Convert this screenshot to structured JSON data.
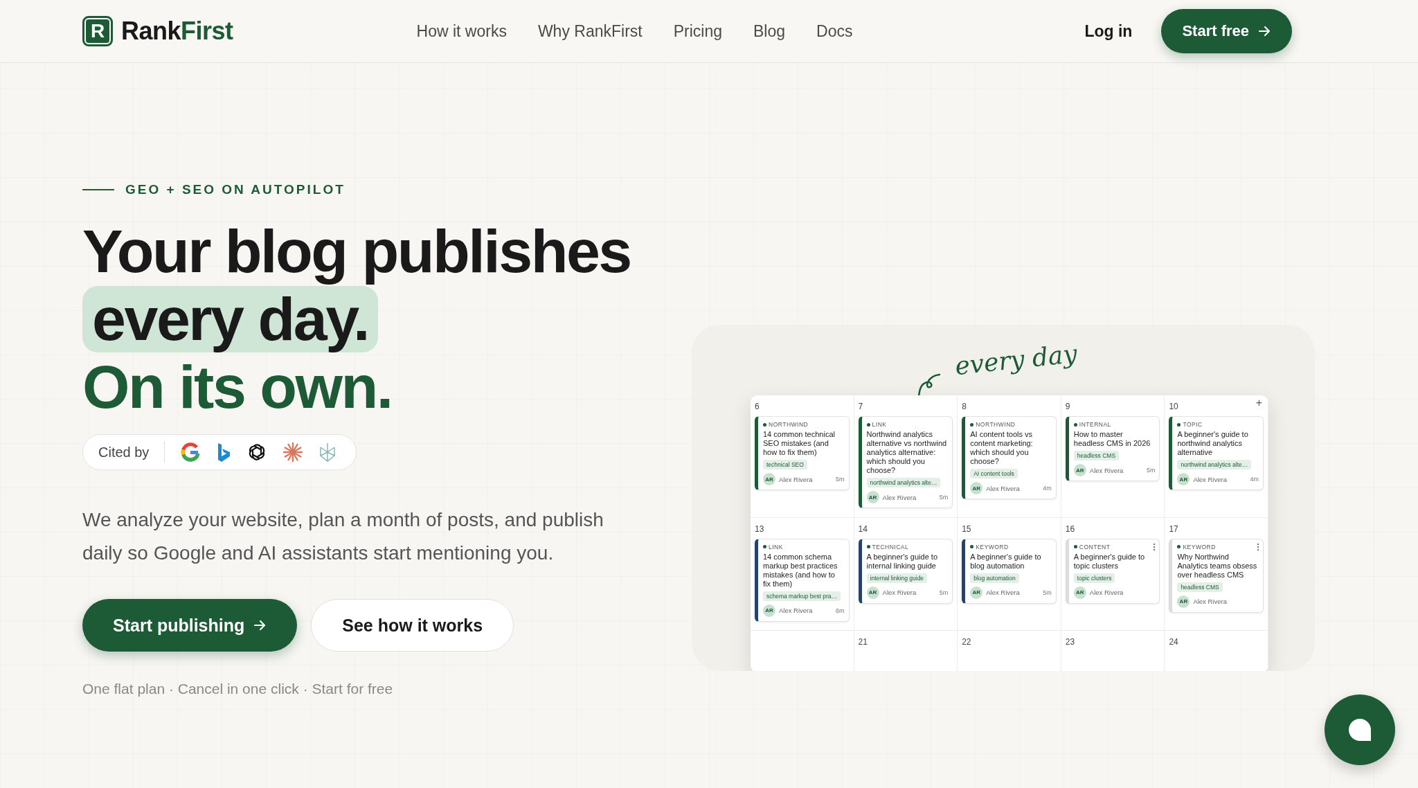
{
  "header": {
    "logo": {
      "mark": "R",
      "name_start": "Rank",
      "name_end": "First"
    },
    "nav": [
      "How it works",
      "Why RankFirst",
      "Pricing",
      "Blog",
      "Docs"
    ],
    "login": "Log in",
    "cta": "Start free"
  },
  "hero": {
    "eyebrow": "GEO + SEO ON AUTOPILOT",
    "headline_1": "Your blog publishes",
    "headline_2": "every day.",
    "headline_3": "On its own.",
    "cited_by": "Cited by",
    "description": "We analyze your website, plan a month of posts, and publish daily so Google and AI assistants start mentioning you.",
    "primary_button": "Start publishing",
    "secondary_button": "See how it works",
    "footnote": "One flat plan · Cancel in one click · Start for free"
  },
  "preview": {
    "annotation": "every day",
    "weeks": [
      {
        "days": [
          {
            "day": "6",
            "post": {
              "label": "NORTHWIND",
              "title": "14 common technical SEO mistakes (and how to fix them)",
              "tag": "technical SEO",
              "initials": "AR",
              "author": "Alex Rivera",
              "time": "5m",
              "color": "#1d5a36"
            }
          },
          {
            "day": "7",
            "post": {
              "label": "LINK",
              "title": "Northwind analytics alternative vs northwind analytics alternative: which should you choose?",
              "tag": "northwind analytics alte…",
              "initials": "AR",
              "author": "Alex Rivera",
              "time": "5m",
              "color": "#1d5a36"
            }
          },
          {
            "day": "8",
            "post": {
              "label": "NORTHWIND",
              "title": "AI content tools vs content marketing: which should you choose?",
              "tag": "AI content tools",
              "initials": "AR",
              "author": "Alex Rivera",
              "time": "4m",
              "color": "#1d5a36"
            }
          },
          {
            "day": "9",
            "post": {
              "label": "INTERNAL",
              "title": "How to master headless CMS in 2026",
              "tag": "headless CMS",
              "initials": "AR",
              "author": "Alex Rivera",
              "time": "5m",
              "color": "#1d5a36"
            }
          },
          {
            "day": "10",
            "add": "+",
            "post": {
              "label": "TOPIC",
              "title": "A beginner's guide to northwind analytics alternative",
              "tag": "northwind analytics alte…",
              "initials": "AR",
              "author": "Alex Rivera",
              "time": "4m",
              "color": "#1d5a36"
            }
          }
        ]
      },
      {
        "days": [
          {
            "day": "13",
            "post": {
              "label": "LINK",
              "title": "14 common schema markup best practices mistakes (and how to fix them)",
              "tag": "schema markup best pra…",
              "initials": "AR",
              "author": "Alex Rivera",
              "time": "6m",
              "color": "#24446a"
            }
          },
          {
            "day": "14",
            "post": {
              "label": "TECHNICAL",
              "title": "A beginner's guide to internal linking guide",
              "tag": "internal linking guide",
              "initials": "AR",
              "author": "Alex Rivera",
              "time": "5m",
              "color": "#24446a"
            }
          },
          {
            "day": "15",
            "post": {
              "label": "KEYWORD",
              "title": "A beginner's guide to blog automation",
              "tag": "blog automation",
              "initials": "AR",
              "author": "Alex Rivera",
              "time": "5m",
              "color": "#24446a"
            }
          },
          {
            "day": "16",
            "post": {
              "label": "CONTENT",
              "title": "A beginner's guide to topic clusters",
              "tag": "topic clusters",
              "initials": "AR",
              "author": "Alex Rivera",
              "color": "#dcdcdc"
            }
          },
          {
            "day": "17",
            "post": {
              "label": "KEYWORD",
              "title": "Why Northwind Analytics teams obsess over headless CMS",
              "tag": "headless CMS",
              "initials": "AR",
              "author": "Alex Rivera",
              "color": "#dcdcdc"
            }
          }
        ]
      },
      {
        "days": [
          {
            "day": "21"
          },
          {
            "day": "22"
          },
          {
            "day": "23"
          },
          {
            "day": "24"
          }
        ]
      }
    ]
  }
}
